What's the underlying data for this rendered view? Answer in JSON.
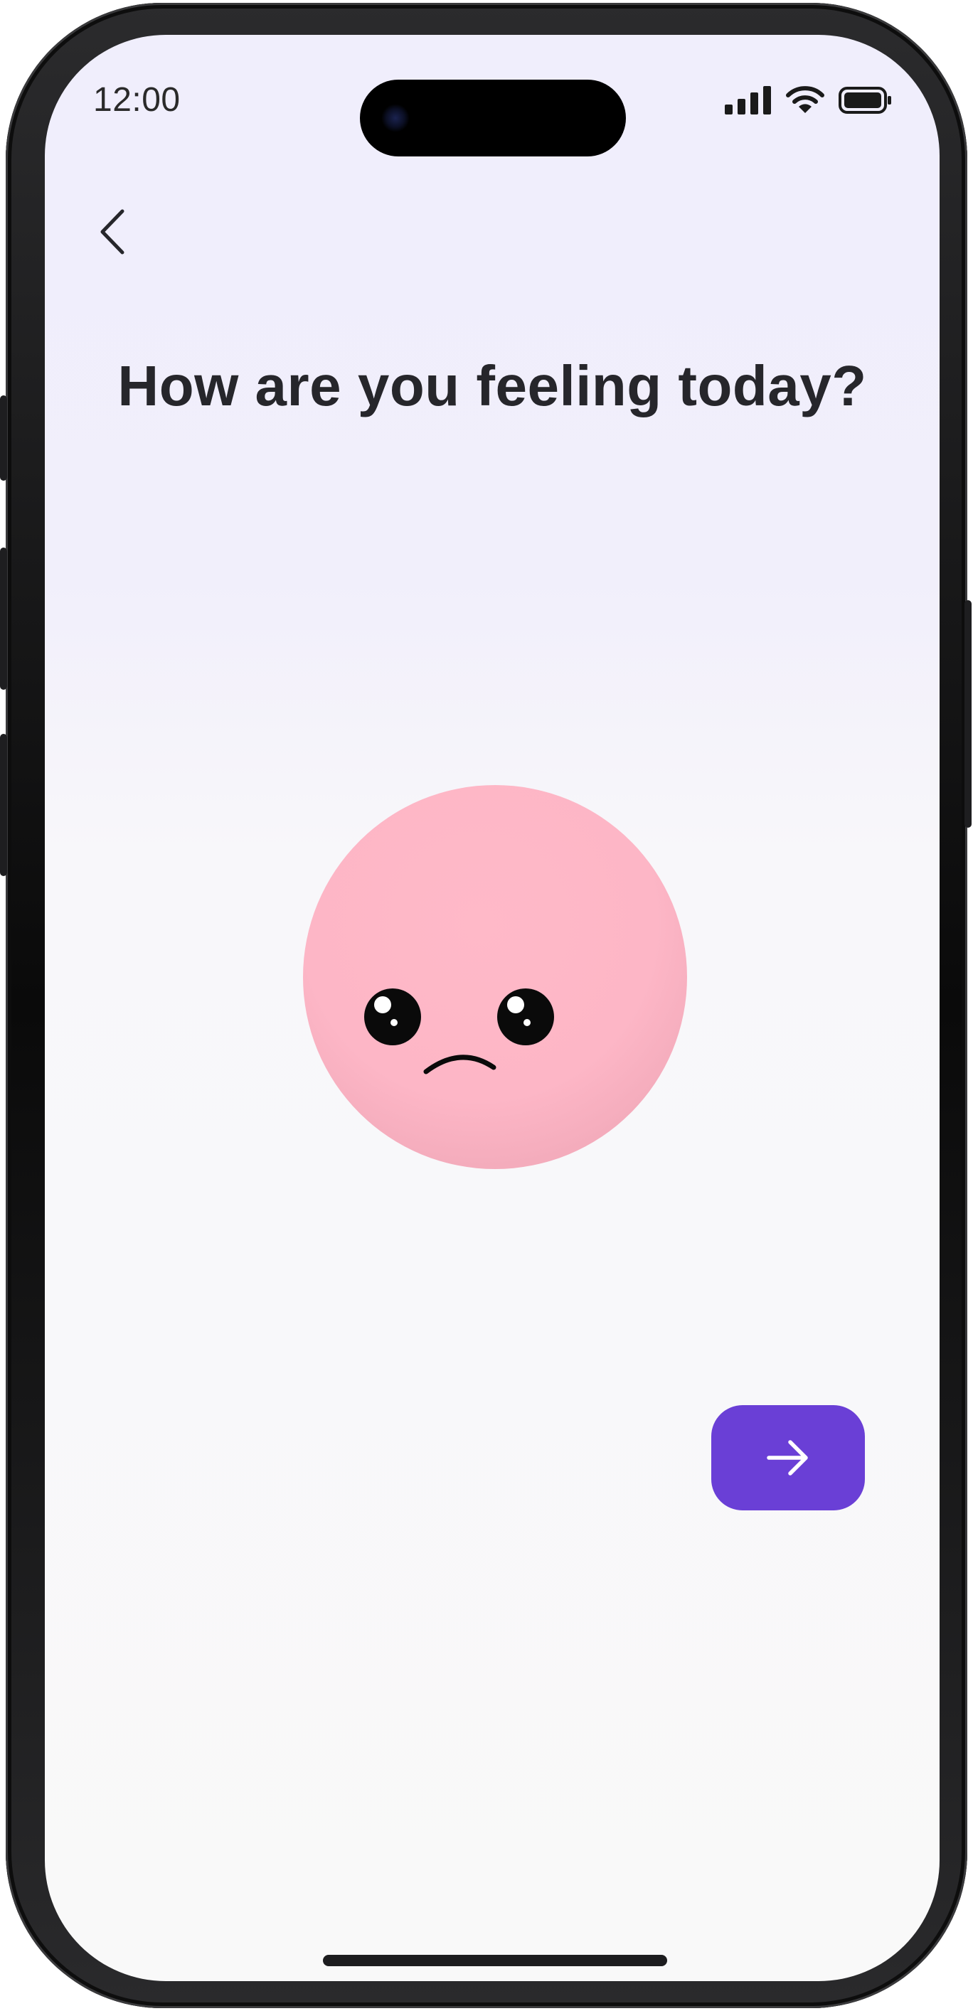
{
  "status_bar": {
    "time": "12:00",
    "icons": [
      "signal-icon",
      "wifi-icon",
      "battery-icon"
    ]
  },
  "header": {
    "back_icon": "chevron-left-icon"
  },
  "main": {
    "title": "How are you feeling today?",
    "mood_face": {
      "expression": "sad",
      "color": "#fdb6c6"
    }
  },
  "actions": {
    "next_icon": "arrow-right-icon",
    "next_color": "#6a3fd6"
  }
}
